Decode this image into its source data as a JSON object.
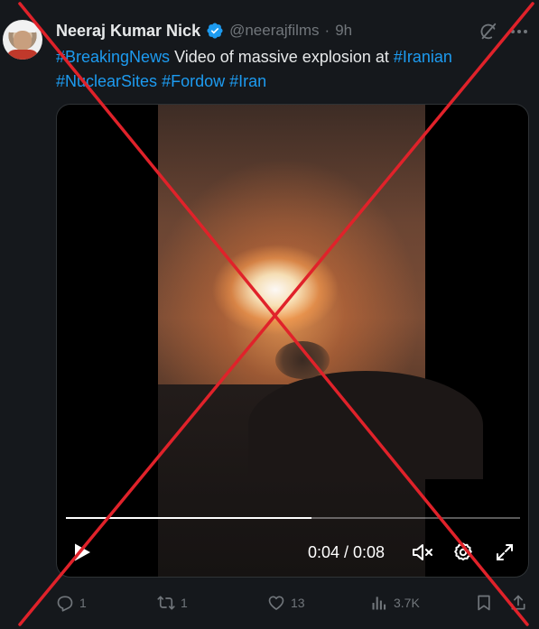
{
  "author": {
    "name": "Neeraj Kumar Nick",
    "handle": "@neerajfilms",
    "separator": "·",
    "time": "9h"
  },
  "tweet": {
    "segments": [
      {
        "text": "#BreakingNews",
        "hashtag": true
      },
      {
        "text": " Video of massive explosion at ",
        "hashtag": false
      },
      {
        "text": "#Iranian",
        "hashtag": true
      },
      {
        "text": " ",
        "hashtag": false
      },
      {
        "text": "#NuclearSites",
        "hashtag": true
      },
      {
        "text": " ",
        "hashtag": false
      },
      {
        "text": "#Fordow",
        "hashtag": true
      },
      {
        "text": " ",
        "hashtag": false
      },
      {
        "text": "#Iran",
        "hashtag": true
      }
    ]
  },
  "video": {
    "timecode": "0:04 / 0:08",
    "progress": 0.54
  },
  "actions": {
    "replies": "1",
    "reposts": "1",
    "likes": "13",
    "views": "3.7K"
  },
  "overlay": {
    "cross_color": "#e0222a"
  },
  "colors": {
    "background": "#15181c",
    "hashtag": "#1d9bf0",
    "verified": "#1d9bf0",
    "muted": "#71767b"
  }
}
